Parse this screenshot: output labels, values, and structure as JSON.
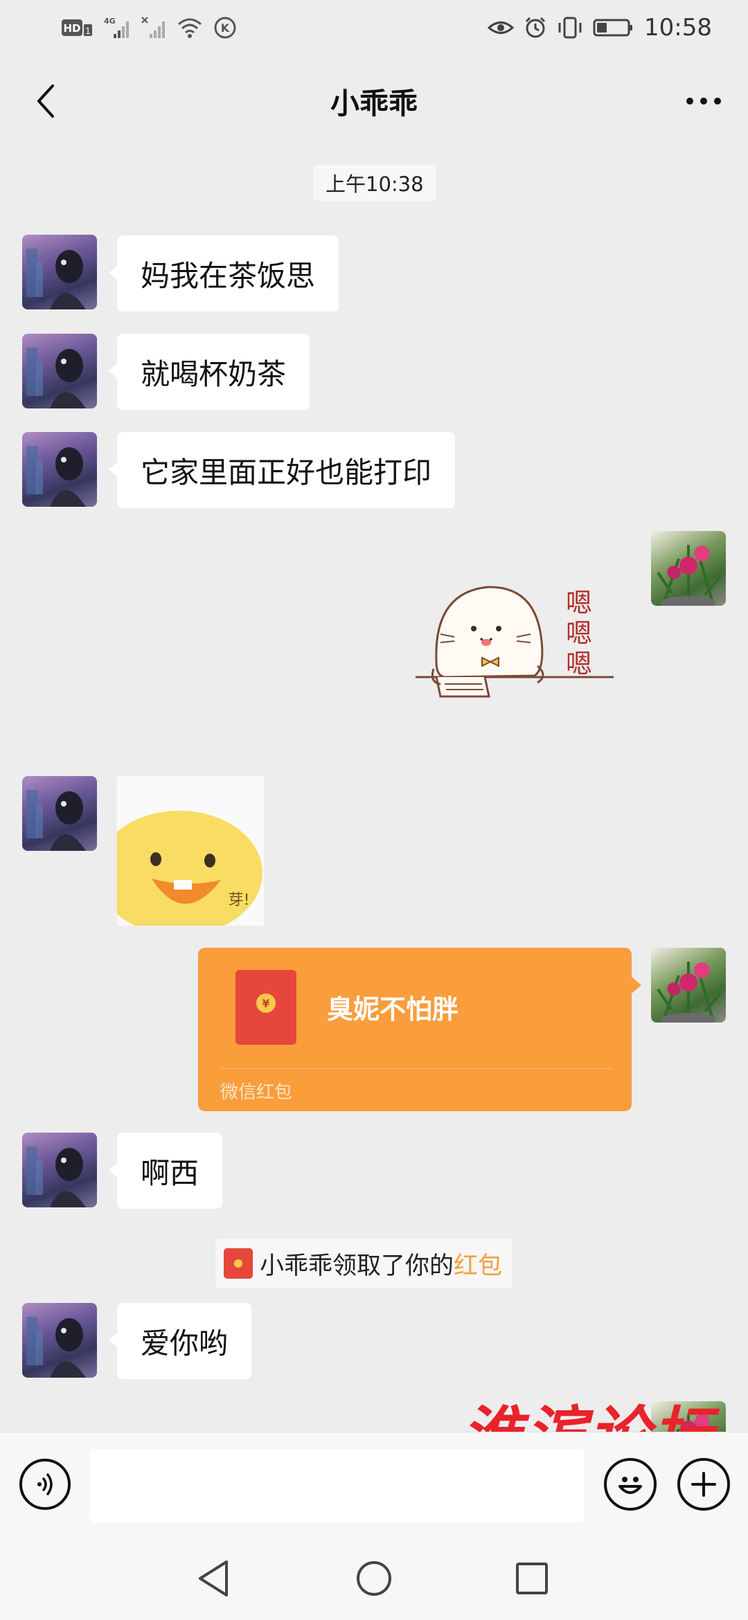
{
  "status_bar": {
    "left_badges": [
      "HD",
      "4G"
    ],
    "time": "10:58",
    "icons": [
      "hd-icon",
      "signal-4g-icon",
      "signal-off-icon",
      "wifi-icon",
      "k-icon",
      "eye-icon",
      "alarm-icon",
      "vibrate-icon",
      "battery-icon"
    ]
  },
  "header": {
    "title": "小乖乖",
    "back_icon": "chevron-left-icon",
    "more_icon": "more-dots-icon"
  },
  "chat": {
    "timestamp": "上午10:38",
    "messages": [
      {
        "from": "peer",
        "type": "text",
        "text": "妈我在茶饭思"
      },
      {
        "from": "peer",
        "type": "text",
        "text": "就喝杯奶茶"
      },
      {
        "from": "peer",
        "type": "text",
        "text": "它家里面正好也能打印"
      },
      {
        "from": "self",
        "type": "sticker",
        "caption": [
          "嗯",
          "嗯",
          "嗯"
        ]
      },
      {
        "from": "peer",
        "type": "sticker",
        "caption": "芽!"
      },
      {
        "from": "self",
        "type": "red_packet",
        "title": "臭妮不怕胖",
        "footer": "微信红包"
      },
      {
        "from": "peer",
        "type": "text",
        "text": "啊西"
      },
      {
        "from": "peer",
        "type": "text",
        "text": "爱你哟"
      }
    ],
    "system_message": {
      "prefix": "小乖乖领取了你的",
      "link": "红包"
    },
    "watermark": "淮滨论坛"
  },
  "input_bar": {
    "text_value": "",
    "voice_icon": "voice-icon",
    "emoji_icon": "emoji-icon",
    "plus_icon": "plus-icon"
  },
  "nav_bar": {
    "icons": [
      "nav-back-icon",
      "nav-home-icon",
      "nav-recents-icon"
    ]
  },
  "colors": {
    "background": "#ededed",
    "bubble_peer": "#ffffff",
    "red_packet": "#fa9d3b",
    "red_envelope": "#e5473a",
    "link_orange": "#f0a13c",
    "watermark_red": "#e8232b"
  }
}
